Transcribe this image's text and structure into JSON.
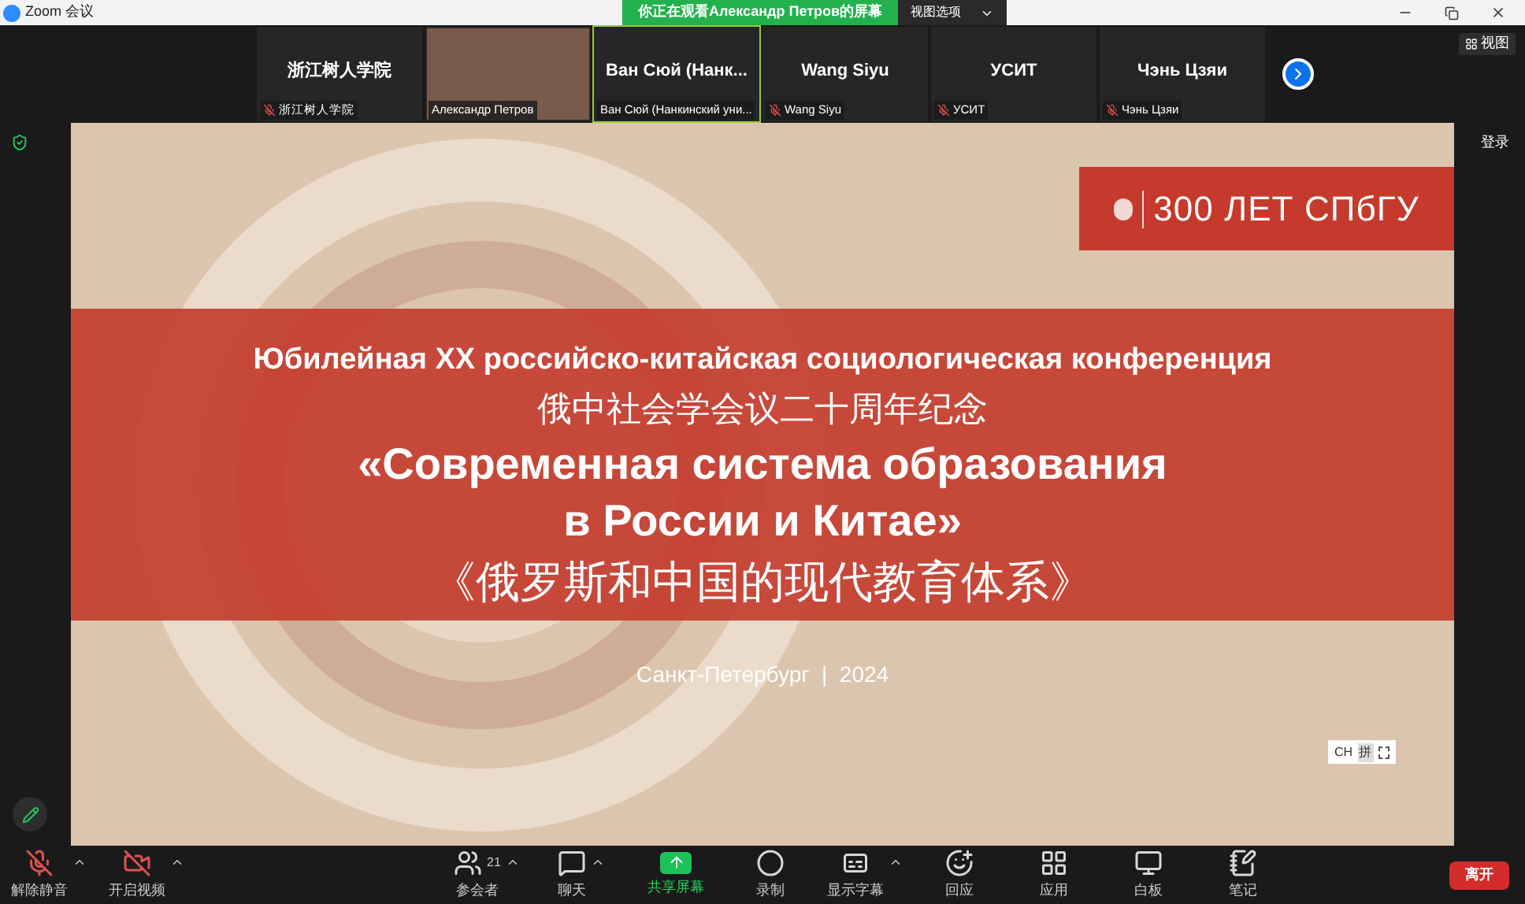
{
  "window": {
    "title": "Zoom 会议"
  },
  "banner": {
    "text": "你正在观看Александр Петров的屏幕",
    "view_options": "视图选项"
  },
  "participants": [
    {
      "kind": "name",
      "display": "浙江树人学院",
      "label": "浙江树人学院",
      "muted": true,
      "speaking": false
    },
    {
      "kind": "video",
      "label": "Александр Петров",
      "muted": false,
      "speaking": false
    },
    {
      "kind": "name",
      "display": "Ван Сюй (Нанк...",
      "label": "Ван Сюй (Нанкинский уни...",
      "muted": false,
      "speaking": true
    },
    {
      "kind": "name",
      "display": "Wang Siyu",
      "label": "Wang Siyu",
      "muted": true,
      "speaking": false
    },
    {
      "kind": "name",
      "display": "УСИТ",
      "label": "УСИТ",
      "muted": true,
      "speaking": false
    },
    {
      "kind": "name",
      "display": "Чэнь Цзяи",
      "label": "Чэнь Цзяи",
      "muted": true,
      "speaking": false
    }
  ],
  "view_button": "视图",
  "sign_in": "登录",
  "slide": {
    "logo": "300 ЛЕТ СПбГУ",
    "lines": [
      {
        "kind": "subtitle",
        "text": "Юбилейная XX российско-китайская социологическая конференция"
      },
      {
        "kind": "cjk",
        "text": "俄中社会学会议二十周年纪念"
      },
      {
        "kind": "title",
        "text": "«Современная система образования"
      },
      {
        "kind": "title",
        "text": "в России и Китае»"
      },
      {
        "kind": "cjk_title",
        "text": "《俄罗斯和中国的现代教育体系》"
      }
    ],
    "footer": "Санкт-Петербург  |  2024"
  },
  "ime": {
    "mode": "CH",
    "pinyin": "拼"
  },
  "toolbar": [
    {
      "kind": "mic",
      "label": "解除静音",
      "caret": true
    },
    {
      "kind": "camera",
      "label": "开启视频",
      "caret": true
    },
    {
      "kind": "participants",
      "label": "参会者",
      "count": "21",
      "caret": true
    },
    {
      "kind": "chat",
      "label": "聊天",
      "caret": true
    },
    {
      "kind": "share",
      "label": "共享屏幕",
      "caret": false
    },
    {
      "kind": "record",
      "label": "录制",
      "caret": false
    },
    {
      "kind": "captions",
      "label": "显示字幕",
      "caret": true
    },
    {
      "kind": "reactions",
      "label": "回应",
      "caret": false
    },
    {
      "kind": "apps",
      "label": "应用",
      "caret": false
    },
    {
      "kind": "whiteboard",
      "label": "白板",
      "caret": false
    },
    {
      "kind": "notes",
      "label": "笔记",
      "caret": false
    }
  ],
  "leave": "离开"
}
